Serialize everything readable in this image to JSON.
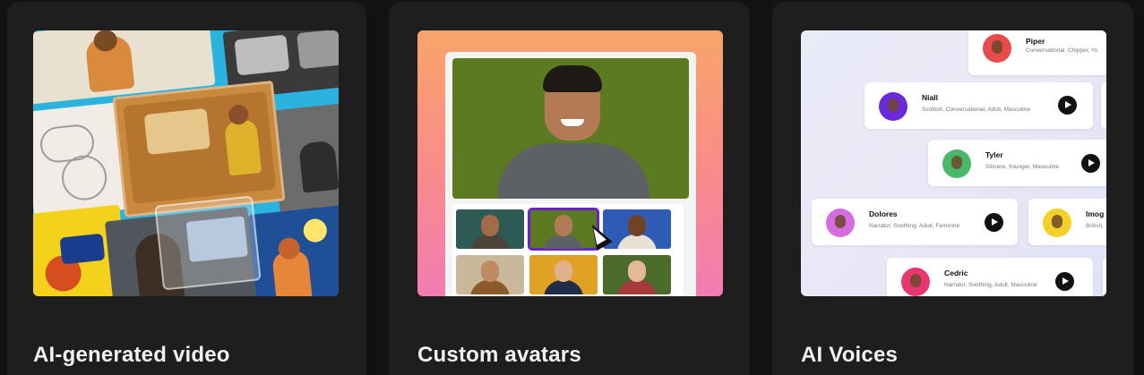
{
  "cards": [
    {
      "title": "AI-generated video",
      "image_alt": "collage-of-train-commuter-illustrations"
    },
    {
      "title": "Custom avatars",
      "image_alt": "avatar-selector-preview"
    },
    {
      "title": "AI Voices",
      "image_alt": "voice-list-preview"
    }
  ],
  "voices": [
    {
      "name": "Piper",
      "desc": "Conversational, Chipper, Yo",
      "avatar_color": "#e94a4a"
    },
    {
      "name": "Niall",
      "desc": "Scottish, Conversational, Adult, Masculine",
      "avatar_color": "#6b2ad9"
    },
    {
      "name": "Tyler",
      "desc": "Sincere, Younger, Masculine",
      "avatar_color": "#4ab86b"
    },
    {
      "name": "Dolores",
      "desc": "Narrator, Soothing, Adult, Feminine",
      "avatar_color": "#d76be0"
    },
    {
      "name": "Imog",
      "desc": "British,",
      "avatar_color": "#f2d027"
    },
    {
      "name": "Cedric",
      "desc": "Narrator, Soothing, Adult, Masculine",
      "avatar_color": "#e8376f"
    }
  ],
  "colors": {
    "page_bg": "#121212",
    "card_bg": "#1e1e1e",
    "title_text": "#f2f2f2",
    "selected_avatar_outline": "#6a1fd1"
  }
}
